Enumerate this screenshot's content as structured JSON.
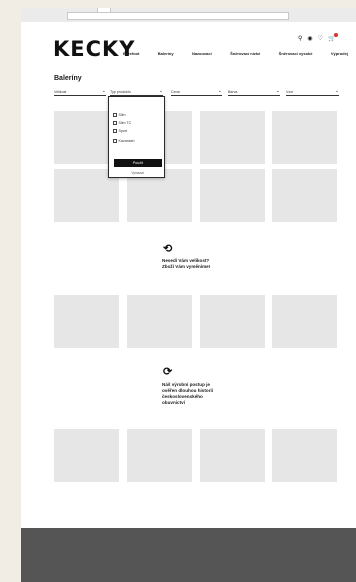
{
  "logo": "KECKY",
  "header_icons": {
    "search": "⚲",
    "account": "◉",
    "wishlist": "♡",
    "cart": "🛒"
  },
  "nav": [
    "Barefoot",
    "Baleríny",
    "Nazouvací",
    "Šněrovací nízké",
    "Šněrovací vysoké",
    "Výprodej"
  ],
  "page_title": "Baleríny",
  "filters": [
    {
      "label": "Velikost",
      "chevron": "⌄"
    },
    {
      "label": "Typ produktu",
      "chevron": "⌄"
    },
    {
      "label": "Cena",
      "chevron": "⌄"
    },
    {
      "label": "Barva",
      "chevron": "⌄"
    },
    {
      "label": "Vzor",
      "chevron": "⌄"
    }
  ],
  "dropdown": {
    "options": [
      "Slim",
      "Slim TC",
      "Sport",
      "Kavanách"
    ],
    "apply_label": "Použít",
    "reset_label": "Vymazat"
  },
  "promos": [
    {
      "icon": "⟲",
      "text": [
        "Nesedí Vám velikost?",
        "Zboží Vám vyměníme!"
      ]
    },
    {
      "icon": "⟳",
      "text": [
        "Náš výrobní postup je",
        "ověřen dlouhou historií",
        "československého",
        "obuvnictví"
      ]
    }
  ]
}
